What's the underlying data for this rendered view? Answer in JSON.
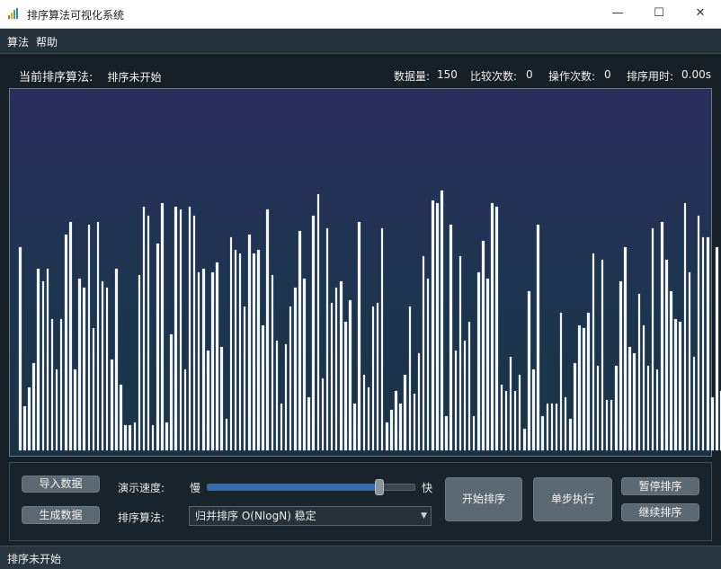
{
  "window": {
    "title": "排序算法可视化系统",
    "min_glyph": "—",
    "max_glyph": "☐",
    "close_glyph": "✕"
  },
  "menu": {
    "items": [
      "算法",
      "帮助"
    ]
  },
  "info": {
    "current_algo_label": "当前排序算法:",
    "current_algo_value": "排序未开始",
    "stats": [
      {
        "label": "数据量:",
        "value": "150"
      },
      {
        "label": "比较次数:",
        "value": "0"
      },
      {
        "label": "操作次数:",
        "value": "0"
      },
      {
        "label": "排序用时:",
        "value": "0.00s"
      }
    ]
  },
  "chart_data": {
    "type": "bar",
    "count": 150,
    "ylim": [
      0,
      100
    ],
    "values": [
      65,
      14,
      20,
      28,
      58,
      54,
      58,
      42,
      26,
      42,
      69,
      73,
      26,
      55,
      52,
      72,
      39,
      73,
      54,
      52,
      29,
      58,
      21,
      8,
      8,
      9,
      56,
      78,
      75,
      8,
      66,
      79,
      9,
      37,
      78,
      77,
      26,
      78,
      75,
      57,
      58,
      32,
      57,
      60,
      33,
      10,
      68,
      64,
      63,
      46,
      69,
      63,
      64,
      40,
      77,
      56,
      35,
      15,
      34,
      46,
      52,
      70,
      55,
      17,
      75,
      82,
      23,
      71,
      47,
      52,
      54,
      41,
      48,
      15,
      73,
      24,
      20,
      46,
      47,
      71,
      9,
      13,
      19,
      15,
      24,
      46,
      18,
      31,
      62,
      55,
      80,
      79,
      83,
      11,
      72,
      32,
      62,
      35,
      41,
      11,
      57,
      67,
      55,
      79,
      78,
      21,
      19,
      30,
      19,
      24,
      7,
      51,
      26,
      72,
      11,
      15,
      15,
      15,
      44,
      17,
      10,
      28,
      40,
      39,
      44,
      63,
      27,
      61,
      16,
      16,
      27,
      54,
      65,
      33,
      31,
      50,
      40,
      27,
      71,
      26,
      73,
      61,
      51,
      42,
      41,
      79,
      57,
      30,
      75,
      68,
      68,
      17,
      65,
      19,
      32,
      44,
      38,
      11,
      61
    ]
  },
  "controls": {
    "import_btn": "导入数据",
    "generate_btn": "生成数据",
    "speed_label": "演示速度:",
    "speed_slow": "慢",
    "speed_fast": "快",
    "speed_value_pct": 83,
    "algo_label": "排序算法:",
    "algo_selected": "归并排序  O(NlogN) 稳定",
    "start_btn": "开始排序",
    "step_btn": "单步执行",
    "pause_btn": "暂停排序",
    "continue_btn": "继续排序"
  },
  "status": {
    "text": "排序未开始"
  },
  "colors": {
    "bar": "#f4f6f8",
    "accent": "#2c6fb8"
  }
}
